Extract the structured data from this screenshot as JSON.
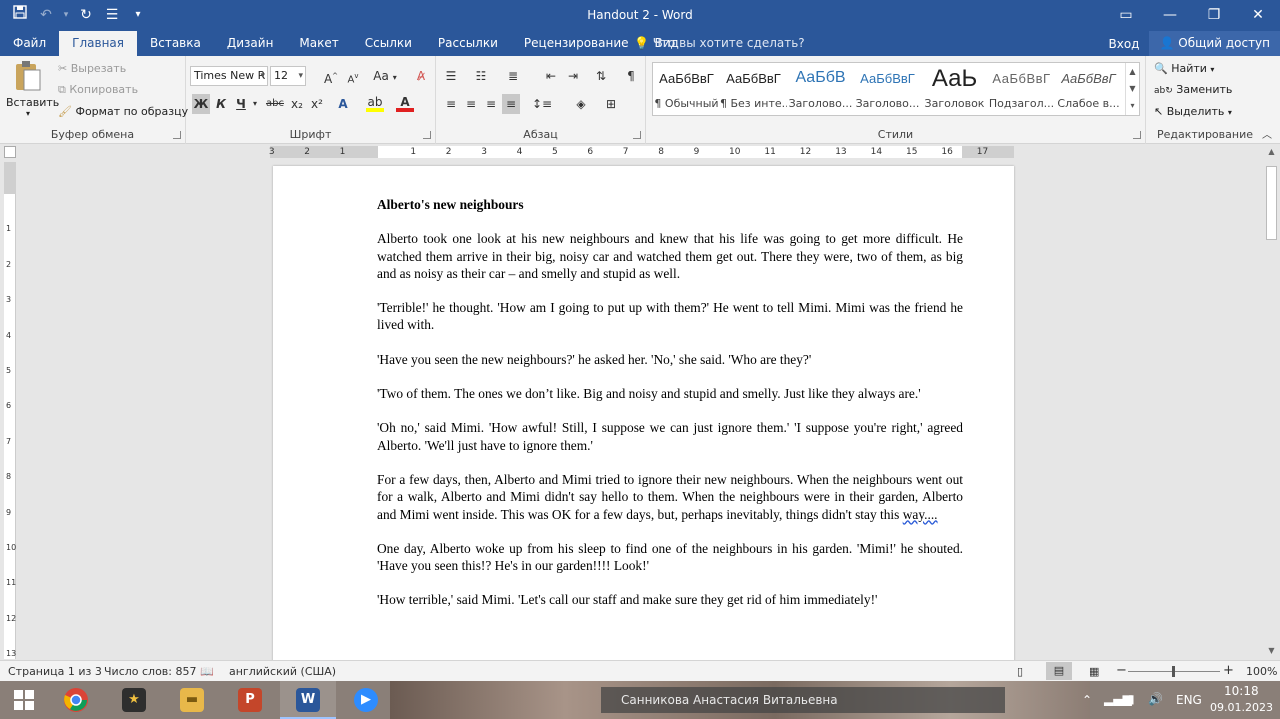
{
  "window": {
    "title": "Handout 2 - Word"
  },
  "tabs": {
    "items": [
      "Файл",
      "Главная",
      "Вставка",
      "Дизайн",
      "Макет",
      "Ссылки",
      "Рассылки",
      "Рецензирование",
      "Вид"
    ],
    "active": "Главная",
    "tell_me": "Что вы хотите сделать?",
    "login": "Вход",
    "share": "Общий доступ"
  },
  "clipboard": {
    "paste": "Вставить",
    "cut": "Вырезать",
    "copy": "Копировать",
    "format_painter": "Формат по образцу",
    "label": "Буфер обмена"
  },
  "font": {
    "name": "Times New R",
    "size": "12",
    "bold": "Ж",
    "italic": "К",
    "underline": "Ч",
    "strike": "abc",
    "sub": "x₂",
    "sup": "x²",
    "grow": "A",
    "shrink": "A",
    "case": "Aa",
    "label": "Шрифт"
  },
  "paragraph": {
    "label": "Абзац"
  },
  "styles": {
    "items": [
      {
        "preview": "АаБбВвГ",
        "name": "¶ Обычный"
      },
      {
        "preview": "АаБбВвГ",
        "name": "¶ Без инте..."
      },
      {
        "preview": "АаБбВ",
        "name": "Заголово..."
      },
      {
        "preview": "АаБбВвГ",
        "name": "Заголово..."
      },
      {
        "preview": "АаЬ",
        "name": "Заголовок"
      },
      {
        "preview": "АаБбВвГ",
        "name": "Подзагол..."
      },
      {
        "preview": "АаБбВвГ",
        "name": "Слабое в..."
      }
    ],
    "label": "Стили"
  },
  "editing": {
    "find": "Найти",
    "replace": "Заменить",
    "select": "Выделить",
    "label": "Редактирование"
  },
  "ruler": {
    "numbers": [
      "3",
      "2",
      "1",
      "1",
      "2",
      "3",
      "4",
      "5",
      "6",
      "7",
      "8",
      "9",
      "10",
      "11",
      "12",
      "13",
      "14",
      "15",
      "16",
      "17"
    ],
    "vnumbers": [
      "1",
      "2",
      "3",
      "4",
      "5",
      "6",
      "7",
      "8",
      "9",
      "10",
      "11",
      "12",
      "13"
    ]
  },
  "document": {
    "heading": "Alberto's new neighbours",
    "paragraphs": [
      "Alberto took one look at his new neighbours and knew that his life was going to get more difficult. He watched them arrive in their big, noisy car and watched them get out. There they were, two of them, as big and as noisy as their car – and smelly and stupid as well.",
      "'Terrible!' he thought. 'How am I going to put up with them?' He went to tell Mimi. Mimi was the friend he lived with.",
      "'Have you seen the new neighbours?' he asked her. 'No,' she said. 'Who are they?'",
      "'Two of them. The ones we don’t like. Big and noisy and stupid and smelly. Just like they always are.'",
      "'Oh no,' said Mimi. 'How awful! Still, I suppose we can just ignore them.' 'I suppose you're right,' agreed Alberto. 'We'll just have to ignore them.'",
      "For a few days, then, Alberto and Mimi tried to ignore their new neighbours. When the neighbours went out for a walk, Alberto and Mimi didn't say hello to them. When the neighbours were in their garden, Alberto and Mimi went inside. This was OK for a few days, but, perhaps inevitably, things didn't stay this way....",
      "One day, Alberto woke up from his sleep to find one of the neighbours in his garden. 'Mimi!' he shouted. 'Have you seen this!? He's in our garden!!!! Look!'",
      "'How terrible,' said Mimi. 'Let's call our staff and make sure they get rid of him immediately!'"
    ]
  },
  "status": {
    "page": "Страница 1 из 3",
    "words": "Число слов: 857",
    "language": "английский (США)",
    "zoom": "100%",
    "zoom_level": 100
  },
  "taskbar": {
    "user": "Санникова Анастасия Витальевна",
    "lang": "ENG",
    "time": "10:18",
    "date": "09.01.2023"
  },
  "colors": {
    "accent": "#2b579a",
    "ribbon": "#f3f3f3"
  }
}
